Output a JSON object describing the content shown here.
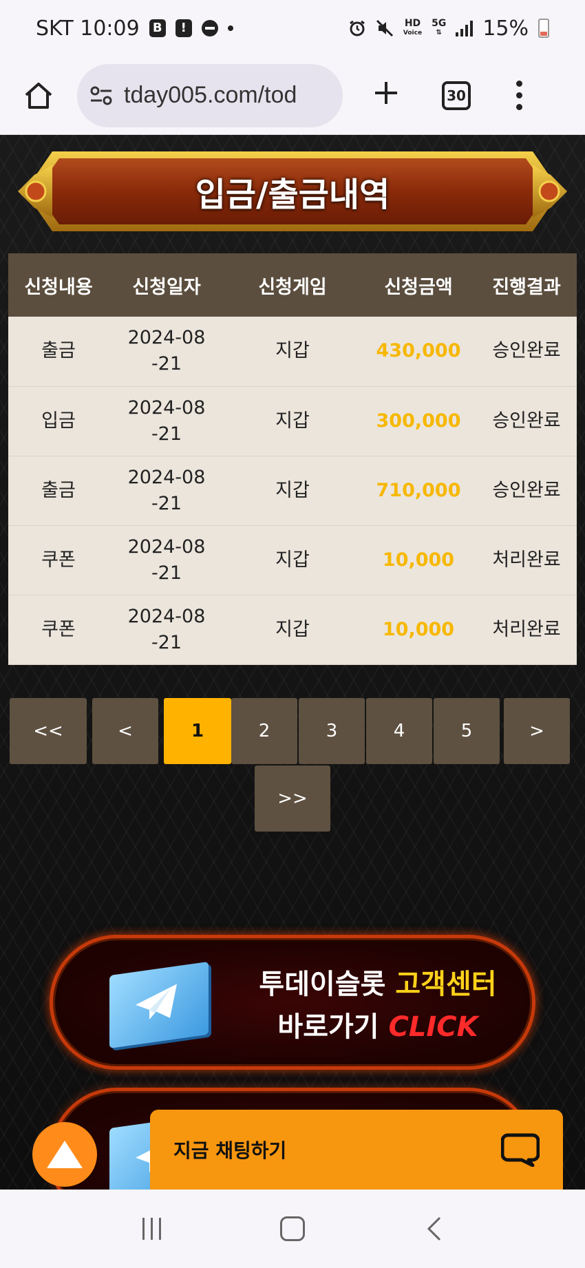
{
  "status_bar": {
    "carrier_time": "SKT 10:09",
    "battery": "15%",
    "icon_b": "B",
    "icon_alert": "!",
    "network_hd": "HD",
    "network_voice": "Voice",
    "network_5g": "5G"
  },
  "browser": {
    "url": "tday005.com/tod",
    "tab_count": "30"
  },
  "page": {
    "title": "입금/출금내역",
    "table": {
      "headers": [
        "신청내용",
        "신청일자",
        "신청게임",
        "신청금액",
        "진행결과"
      ],
      "rows": [
        {
          "type": "출금",
          "date": "2024-08-21",
          "game": "지갑",
          "amount": "430,000",
          "result": "승인완료"
        },
        {
          "type": "입금",
          "date": "2024-08-21",
          "game": "지갑",
          "amount": "300,000",
          "result": "승인완료"
        },
        {
          "type": "출금",
          "date": "2024-08-21",
          "game": "지갑",
          "amount": "710,000",
          "result": "승인완료"
        },
        {
          "type": "쿠폰",
          "date": "2024-08-21",
          "game": "지갑",
          "amount": "10,000",
          "result": "처리완료"
        },
        {
          "type": "쿠폰",
          "date": "2024-08-21",
          "game": "지갑",
          "amount": "10,000",
          "result": "처리완료"
        }
      ]
    },
    "pagination": {
      "first": "<<",
      "prev": "<",
      "pages": [
        "1",
        "2",
        "3",
        "4",
        "5"
      ],
      "current": "1",
      "next": ">",
      "last": ">>"
    },
    "cta": {
      "line1_white": "투데이슬롯",
      "line1_gold": "고객센터",
      "line2_white": "바로가기",
      "line2_red": "CLICK"
    },
    "chat": {
      "label": "지금 채팅하기"
    }
  },
  "colors": {
    "accent_gold": "#ffb300",
    "amount_gold": "#f7b800",
    "table_header": "#5b4e3e",
    "chat_orange": "#f7960f"
  }
}
